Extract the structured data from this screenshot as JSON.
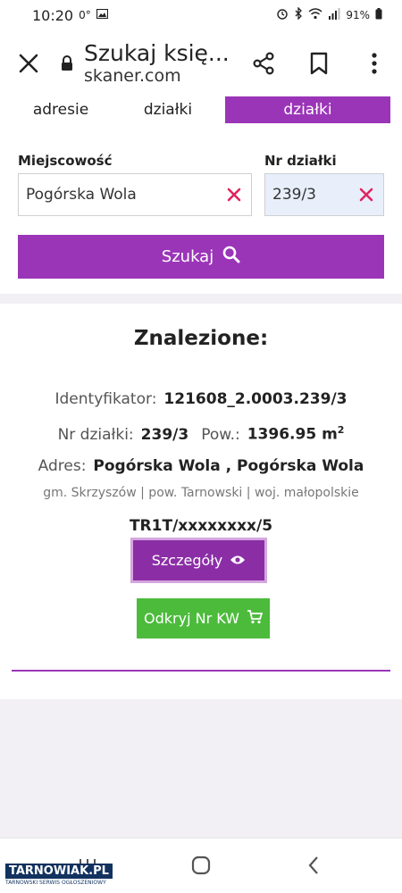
{
  "status_bar": {
    "time": "10:20",
    "temp": "0°",
    "battery": "91%"
  },
  "browser": {
    "close_icon": "close-icon",
    "page_title": "Szukaj księ...",
    "domain": "skaner.com",
    "share_icon": "share-icon",
    "bookmark_icon": "bookmark-icon",
    "menu_icon": "more-vert-icon"
  },
  "tabs": [
    {
      "label": "adresie",
      "active": false
    },
    {
      "label": "działki",
      "active": false
    },
    {
      "label": "działki",
      "active": true
    }
  ],
  "form": {
    "city_label": "Miejscowość",
    "city_value": "Pogórska Wola",
    "plot_label": "Nr działki",
    "plot_value": "239/3",
    "search_label": "Szukaj",
    "accent_color": "#9b35b8",
    "clear_color": "#e0245e"
  },
  "results": {
    "title": "Znalezione:",
    "identifier_label": "Identyfikator:",
    "identifier_value": "121608_2.0003.239/3",
    "plot_label": "Nr działki:",
    "plot_value": "239/3",
    "area_label": "Pow.:",
    "area_value": "1396.95 m",
    "area_unit_sup": "2",
    "address_label": "Adres:",
    "address_value": "Pogórska Wola , Pogórska Wola",
    "admin_line": "gm. Skrzyszów | pow. Tarnowski | woj. małopolskie",
    "kw_number": "TR1T/xxxxxxxx/5",
    "details_label": "Szczegóły",
    "reveal_kw_label": "Odkryj Nr KW",
    "reveal_color": "#4cbb3c"
  },
  "nav": {
    "recents_icon": "recent-apps-icon",
    "home_icon": "home-icon",
    "back_icon": "back-icon"
  },
  "watermark": {
    "brand": "TARNOWIAK.PL",
    "tagline": "TARNOWSKI SERWIS OGŁOSZENIOWY"
  }
}
